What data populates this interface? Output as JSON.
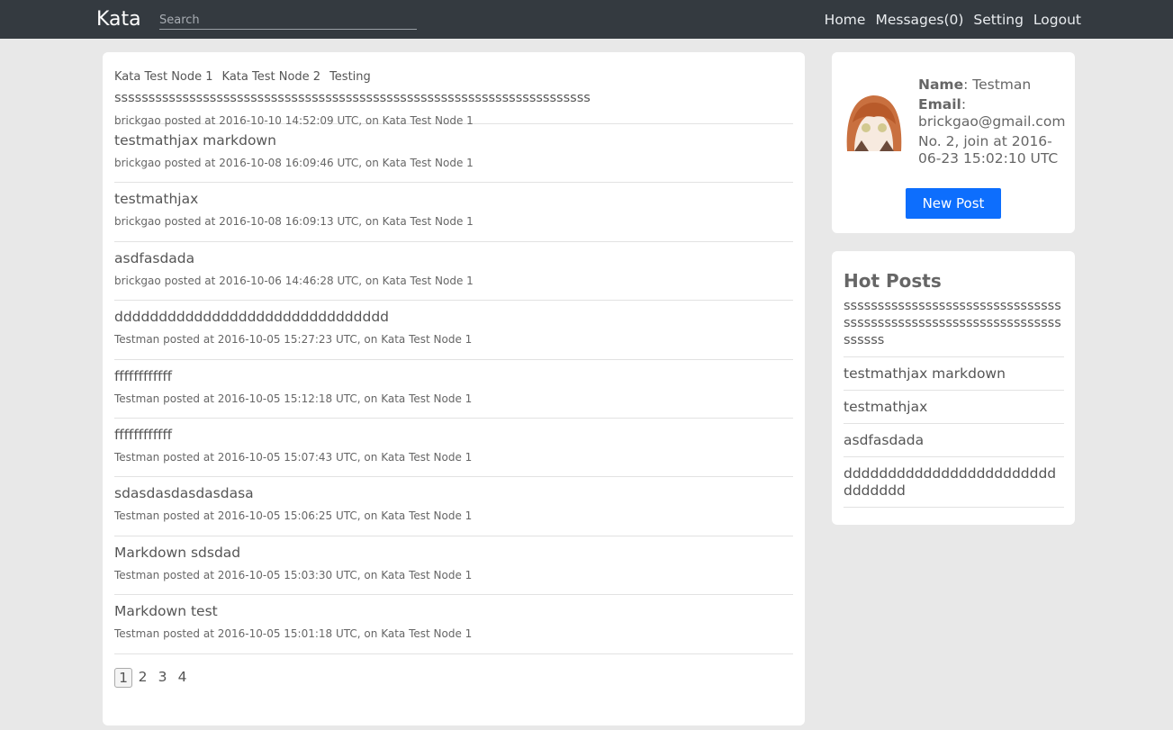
{
  "navbar": {
    "brand": "Kata",
    "search_placeholder": "Search",
    "links": [
      "Home",
      "Messages(0)",
      "Setting",
      "Logout"
    ]
  },
  "nodes": [
    "Kata Test Node 1",
    "Kata Test Node 2",
    "Testing"
  ],
  "posts": [
    {
      "title": "ssssssssssssssssssssssssssssssssssssssssssssssssssssssssssssssssssssss",
      "author": "brickgao",
      "date": "2016-10-10 14:52:09 UTC",
      "node": "Kata Test Node 1"
    },
    {
      "title": "testmathjax markdown",
      "author": "brickgao",
      "date": "2016-10-08 16:09:46 UTC",
      "node": "Kata Test Node 1"
    },
    {
      "title": "testmathjax",
      "author": "brickgao",
      "date": "2016-10-08 16:09:13 UTC",
      "node": "Kata Test Node 1"
    },
    {
      "title": "asdfasdada",
      "author": "brickgao",
      "date": "2016-10-06 14:46:28 UTC",
      "node": "Kata Test Node 1"
    },
    {
      "title": "ddddddddddddddddddddddddddddddd",
      "author": "Testman",
      "date": "2016-10-05 15:27:23 UTC",
      "node": "Kata Test Node 1"
    },
    {
      "title": "ffffffffffff",
      "author": "Testman",
      "date": "2016-10-05 15:12:18 UTC",
      "node": "Kata Test Node 1"
    },
    {
      "title": "ffffffffffff",
      "author": "Testman",
      "date": "2016-10-05 15:07:43 UTC",
      "node": "Kata Test Node 1"
    },
    {
      "title": "sdasdasdasdasdasa",
      "author": "Testman",
      "date": "2016-10-05 15:06:25 UTC",
      "node": "Kata Test Node 1"
    },
    {
      "title": "Markdown sdsdad",
      "author": "Testman",
      "date": "2016-10-05 15:03:30 UTC",
      "node": "Kata Test Node 1"
    },
    {
      "title": "Markdown test",
      "author": "Testman",
      "date": "2016-10-05 15:01:18 UTC",
      "node": "Kata Test Node 1"
    }
  ],
  "meta_text": {
    "posted_at": "posted at",
    "on": ", on"
  },
  "pagination": {
    "pages": [
      "1",
      "2",
      "3",
      "4"
    ],
    "current": "1"
  },
  "profile": {
    "name_label": "Name",
    "name": ": Testman",
    "email_label": "Email",
    "email": ": brickgao@gmail.com",
    "join": "No. 2, join at 2016-06-23 15:02:10 UTC",
    "new_post_label": "New Post"
  },
  "hot_posts": {
    "title": "Hot Posts",
    "items": [
      "ssssssssssssssssssssssssssssssssssssssssssssssssssssssssssssssssssssss",
      "testmathjax markdown",
      "testmathjax",
      "asdfasdada",
      "ddddddddddddddddddddddddddddddd"
    ]
  },
  "colors": {
    "navbar": "#343a40",
    "primary_button": "#0d6efd",
    "background": "#e8e8e8"
  }
}
